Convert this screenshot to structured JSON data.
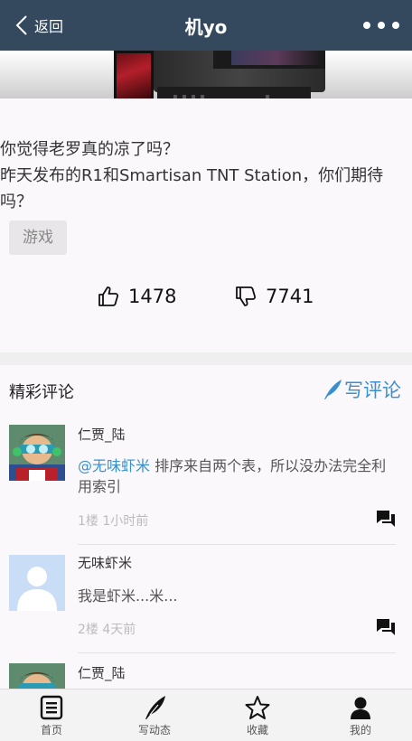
{
  "topbar": {
    "back_label": "返回",
    "title": "机yo"
  },
  "post": {
    "text_line1": "你觉得老罗真的凉了吗？",
    "text_line2": "昨天发布的R1和Smartisan TNT Station，你们期待吗？",
    "tag": "游戏",
    "likes": "1478",
    "dislikes": "7741"
  },
  "comments_section": {
    "title": "精彩评论",
    "write_label": "写评论",
    "items": [
      {
        "user": "仁贾_陆",
        "mention": "@无味虾米",
        "text": " 排序来自两个表，所以没办法完全利用索引",
        "meta": "1楼 1小时前"
      },
      {
        "user": "无味虾米",
        "mention": "",
        "text": "我是虾米...米...",
        "meta": "2楼 4天前"
      },
      {
        "user": "仁贾_陆"
      }
    ]
  },
  "tabbar": {
    "items": [
      {
        "label": "首页"
      },
      {
        "label": "写动态"
      },
      {
        "label": "收藏"
      },
      {
        "label": "我的"
      }
    ]
  },
  "colors": {
    "topbar": "#34495e",
    "accent": "#3a8fd0"
  }
}
